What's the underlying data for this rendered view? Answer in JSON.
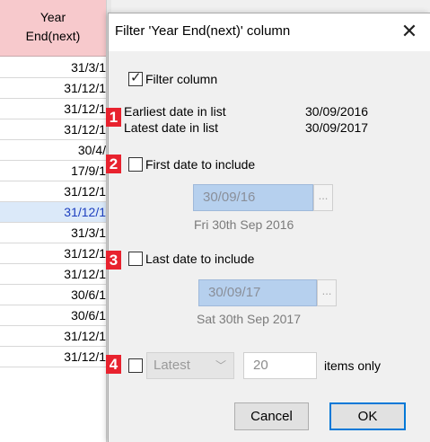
{
  "sheet": {
    "header_line1": "Year",
    "header_line2": "End(next)",
    "rows": [
      {
        "value": "31/3/1"
      },
      {
        "value": "31/12/1"
      },
      {
        "value": "31/12/1"
      },
      {
        "value": "31/12/1"
      },
      {
        "value": "30/4/"
      },
      {
        "value": "17/9/1"
      },
      {
        "value": "31/12/1"
      },
      {
        "value": "31/12/1",
        "selected": true
      },
      {
        "value": "31/3/1"
      },
      {
        "value": "31/12/1"
      },
      {
        "value": "31/12/1"
      },
      {
        "value": "30/6/1"
      },
      {
        "value": "30/6/1"
      },
      {
        "value": "31/12/1"
      },
      {
        "value": "31/12/1"
      }
    ]
  },
  "dialog": {
    "title": "Filter 'Year End(next)' column",
    "close_glyph": "✕",
    "filter_column": {
      "label": "Filter column",
      "checked": true
    },
    "earliest": {
      "label": "Earliest date in list",
      "value": "30/09/2016"
    },
    "latest": {
      "label": "Latest date in list",
      "value": "30/09/2017"
    },
    "first_date": {
      "label": "First date to include",
      "checked": false,
      "input": "30/09/16",
      "button": "...",
      "hint": "Fri 30th Sep 2016"
    },
    "last_date": {
      "label": "Last date to include",
      "checked": false,
      "input": "30/09/17",
      "button": "...",
      "hint": "Sat 30th Sep 2017"
    },
    "items": {
      "checked": false,
      "mode": "Latest",
      "count": "20",
      "suffix": "items only"
    },
    "buttons": {
      "cancel": "Cancel",
      "ok": "OK"
    },
    "badges": [
      "1",
      "2",
      "3",
      "4"
    ],
    "colors": {
      "badge": "#e8222e",
      "date_input": "#b6d0ee",
      "selected_row": "#dbe9f9",
      "header": "#f7c9cc",
      "ok_border": "#0078d7"
    }
  }
}
